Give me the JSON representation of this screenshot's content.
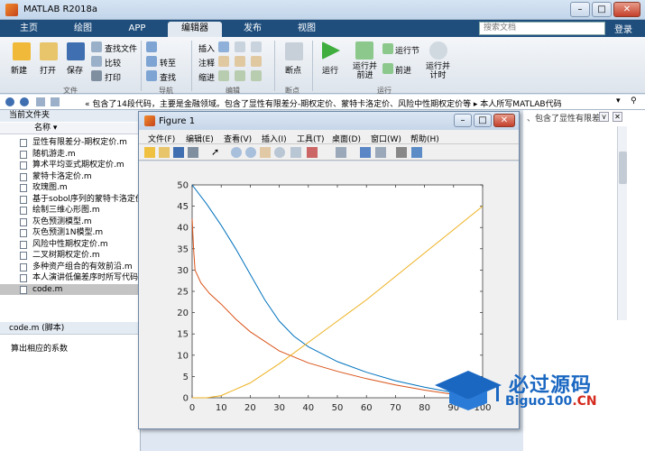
{
  "window": {
    "title": "MATLAB R2018a"
  },
  "tabs": [
    {
      "label": "主页"
    },
    {
      "label": "绘图"
    },
    {
      "label": "APP"
    },
    {
      "label": "编辑器"
    },
    {
      "label": "发布"
    },
    {
      "label": "视图"
    }
  ],
  "search": {
    "placeholder": "搜索文档"
  },
  "login": "登录",
  "ribbon": {
    "new": "新建",
    "open": "打开",
    "save": "保存",
    "find_files": "查找文件",
    "compare": "比较",
    "print": "打印",
    "goto": "转至",
    "find": "查找",
    "insert": "插入",
    "comment": "注释",
    "indent": "缩进",
    "breakpoint": "断点",
    "run": "运行",
    "run_advance": "运行并\n前进",
    "run_section": "运行节",
    "advance": "前进",
    "run_time": "运行并\n计时",
    "sections": {
      "file": "文件",
      "nav": "导航",
      "edit": "编辑",
      "breakpoint": "断点",
      "run": "运行"
    }
  },
  "pathbar": {
    "path": "« 包含了14段代码，主要是金融领域。包含了显性有限差分-期权定价、蒙特卡洛定价、风险中性期权定价等 ▸ 本人所写MATLAB代码"
  },
  "left_panel": {
    "title": "当前文件夹",
    "column_name": "名称 ▾",
    "files": [
      "显性有限差分-期权定价.m",
      "随机游走.m",
      "算术平均亚式期权定价.m",
      "蒙特卡洛定价.m",
      "玫瑰图.m",
      "基于sobol序列的蒙特卡洛定价",
      "绘制三维心形图.m",
      "灰色预测模型.m",
      "灰色预测1N模型.m",
      "风险中性期权定价.m",
      "二叉树期权定价.m",
      "多种资产组合的有效前沿.m",
      "本人演讲低偏差序时所写代码",
      "code.m"
    ],
    "selected_index": 13
  },
  "detail_panel": {
    "title": "code.m (脚本)",
    "description": "算出相应的系数"
  },
  "right_snippet": "、包含了显性有限差...",
  "figure": {
    "title": "Figure 1",
    "menus": [
      "文件(F)",
      "编辑(E)",
      "查看(V)",
      "插入(I)",
      "工具(T)",
      "桌面(D)",
      "窗口(W)",
      "帮助(H)"
    ]
  },
  "chart_data": {
    "type": "line",
    "xlim": [
      0,
      100
    ],
    "ylim": [
      0,
      50
    ],
    "xticks": [
      0,
      10,
      20,
      30,
      40,
      50,
      60,
      70,
      80,
      90,
      100
    ],
    "yticks": [
      0,
      5,
      10,
      15,
      20,
      25,
      30,
      35,
      40,
      45,
      50
    ],
    "series": [
      {
        "color": "#0072bd",
        "x": [
          0,
          5,
          10,
          15,
          20,
          25,
          30,
          35,
          40,
          50,
          60,
          70,
          80,
          90,
          100
        ],
        "y": [
          50,
          45.5,
          40.5,
          35,
          29,
          23,
          18,
          14.5,
          12,
          8.5,
          6,
          4,
          2.5,
          1.2,
          0
        ]
      },
      {
        "color": "#d95319",
        "x": [
          0,
          0.5,
          1,
          3,
          6,
          10,
          15,
          20,
          30,
          40,
          50,
          60,
          70,
          80,
          90,
          100
        ],
        "y": [
          42,
          35,
          30,
          27,
          24.5,
          22,
          18.5,
          15.5,
          11,
          8.2,
          6.2,
          4.5,
          3,
          1.8,
          0.8,
          0
        ]
      },
      {
        "color": "#edb120",
        "x": [
          0,
          5,
          10,
          20,
          30,
          40,
          50,
          60,
          70,
          80,
          90,
          100
        ],
        "y": [
          0,
          0,
          0.5,
          3.5,
          8,
          13,
          18,
          23,
          28.5,
          34,
          39.5,
          45
        ]
      }
    ]
  },
  "watermark": {
    "main": "必过源码",
    "sub_a": "Biguo100",
    "sub_b": ".CN"
  },
  "colors": {
    "tab_bar": "#1f4e7d",
    "series1": "#0072bd",
    "series2": "#d95319",
    "series3": "#edb120"
  }
}
